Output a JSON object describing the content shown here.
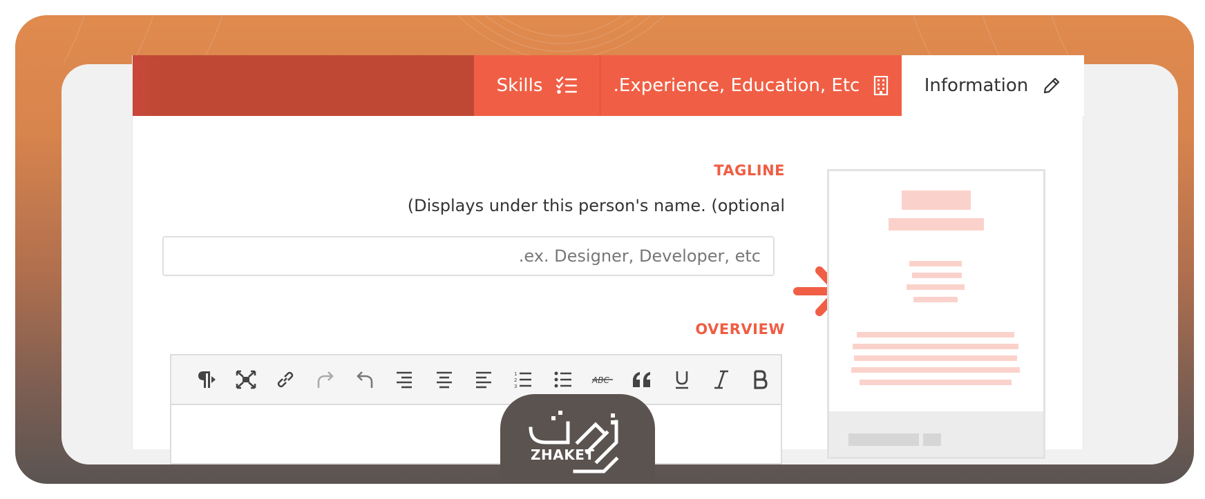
{
  "tabs": [
    {
      "label": "Skills",
      "icon": "checklist-icon"
    },
    {
      "label": ".Experience, Education, Etc",
      "icon": "building-icon"
    },
    {
      "label": "Information",
      "icon": "pencil-icon"
    }
  ],
  "tagline": {
    "title": "TAGLINE",
    "help": "(Displays under this person's name. (optional",
    "placeholder": ".ex. Designer, Developer, etc",
    "value": ""
  },
  "overview": {
    "title": "OVERVIEW",
    "toolbar": [
      "paragraph-direction-icon",
      "fullscreen-icon",
      "link-icon",
      "redo-icon",
      "undo-icon",
      "align-right-icon",
      "align-center-icon",
      "align-left-icon",
      "numbered-list-icon",
      "bulleted-list-icon",
      "strikethrough-icon",
      "blockquote-icon",
      "underline-icon",
      "italic-icon",
      "bold-icon"
    ]
  },
  "brand": {
    "name": "ZHAKET"
  },
  "colors": {
    "accent": "#f05f45",
    "accent_dark": "#bf4834",
    "preview_bar": "#fbd2cb"
  }
}
